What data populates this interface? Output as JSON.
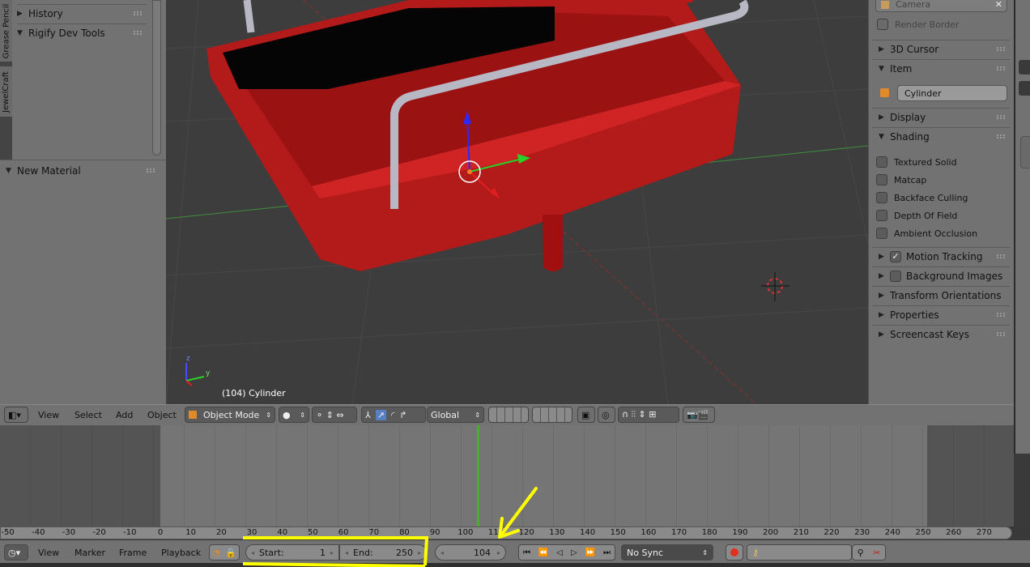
{
  "tool_shelf": {
    "tabs": [
      "Grease Pencil",
      "JewelCraft"
    ],
    "panels": [
      {
        "label": "History",
        "expanded": false
      },
      {
        "label": "Rigify Dev Tools",
        "expanded": true
      }
    ]
  },
  "material_panel": {
    "label": "New Material"
  },
  "viewport": {
    "object_info": "(104) Cylinder",
    "axis_z": "z",
    "axis_y": "y"
  },
  "properties_panel": {
    "camera_field": "Camera",
    "render_border": "Render Border",
    "sections": {
      "cursor": "3D Cursor",
      "item": "Item",
      "display": "Display",
      "shading": "Shading",
      "motion_tracking": "Motion Tracking",
      "background_images": "Background Images",
      "transform_orientations": "Transform Orientations",
      "properties": "Properties",
      "screencast_keys": "Screencast Keys"
    },
    "item_name": "Cylinder",
    "shading_options": [
      {
        "label": "Textured Solid",
        "checked": false
      },
      {
        "label": "Matcap",
        "checked": false
      },
      {
        "label": "Backface Culling",
        "checked": false
      },
      {
        "label": "Depth Of Field",
        "checked": false
      },
      {
        "label": "Ambient Occlusion",
        "checked": false
      }
    ],
    "motion_tracking_checked": true,
    "background_images_checked": false
  },
  "view3d_header": {
    "menus": [
      "View",
      "Select",
      "Add",
      "Object"
    ],
    "mode": "Object Mode",
    "orientation": "Global"
  },
  "timeline": {
    "ticks": [
      -50,
      -40,
      -30,
      -20,
      -10,
      0,
      10,
      20,
      30,
      40,
      50,
      60,
      70,
      80,
      90,
      100,
      110,
      120,
      130,
      140,
      150,
      160,
      170,
      180,
      190,
      200,
      210,
      220,
      230,
      240,
      250,
      260,
      270
    ],
    "current_frame_marker": 104
  },
  "timeline_header": {
    "menus": [
      "View",
      "Marker",
      "Frame",
      "Playback"
    ],
    "start_label": "Start:",
    "start": "1",
    "end_label": "End:",
    "end": "250",
    "current_frame": "104",
    "sync": "No Sync"
  },
  "colors": {
    "annotation": "#ffff00",
    "frame_cursor": "#4caf2a",
    "object": "#b01818"
  }
}
